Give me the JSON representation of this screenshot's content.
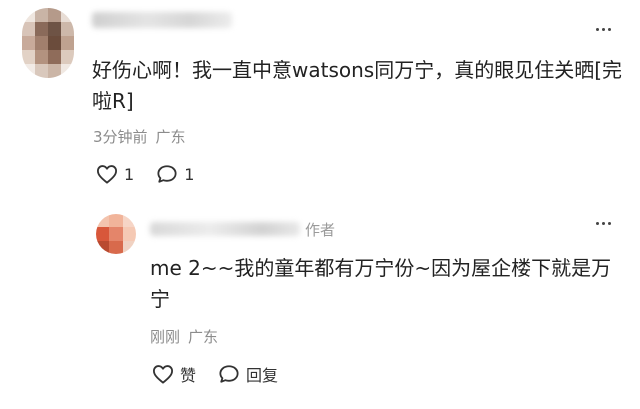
{
  "comments": [
    {
      "text": "好伤心啊！我一直中意watsons同万宁，真的眼见住关晒[完啦R]",
      "time": "3分钟前",
      "location": "广东",
      "like_count": "1",
      "reply_count": "1"
    },
    {
      "author_tag": "作者",
      "text": "me 2~~我的童年都有万宁份~因为屋企楼下就是万宁",
      "time": "刚刚",
      "location": "广东",
      "like_label": "赞",
      "reply_label": "回复"
    }
  ],
  "colors": {
    "text": "#222222",
    "meta": "#8c8c8c",
    "author_tag": "#9a9a9a",
    "background": "#ffffff"
  },
  "icons": {
    "like": "heart-icon",
    "reply": "speech-bubble-icon",
    "more": "more-dots-icon"
  }
}
